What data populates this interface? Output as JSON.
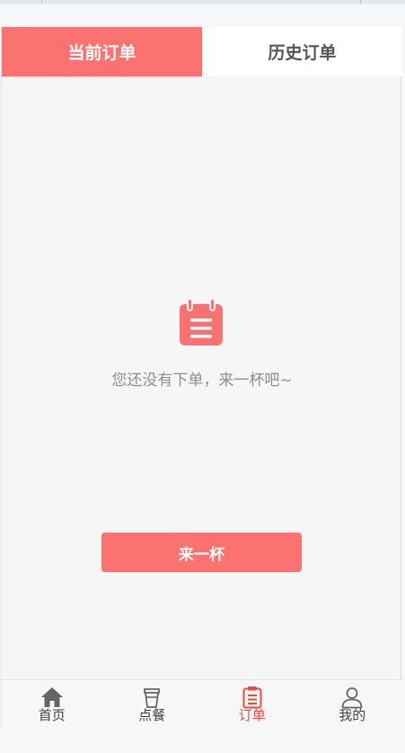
{
  "tabs": {
    "current": "当前订单",
    "history": "历史订单"
  },
  "empty": {
    "icon": "order-clipboard-icon",
    "message": "您还没有下单，来一杯吧~",
    "button_label": "来一杯"
  },
  "nav": {
    "items": [
      {
        "label": "首页",
        "icon": "home-icon"
      },
      {
        "label": "点餐",
        "icon": "cup-icon"
      },
      {
        "label": "订单",
        "icon": "order-icon",
        "active": true
      },
      {
        "label": "我的",
        "icon": "user-icon"
      }
    ]
  },
  "colors": {
    "accent": "#fb7270",
    "active_nav": "#ee4a3e",
    "muted_text": "#8f8f8f"
  }
}
